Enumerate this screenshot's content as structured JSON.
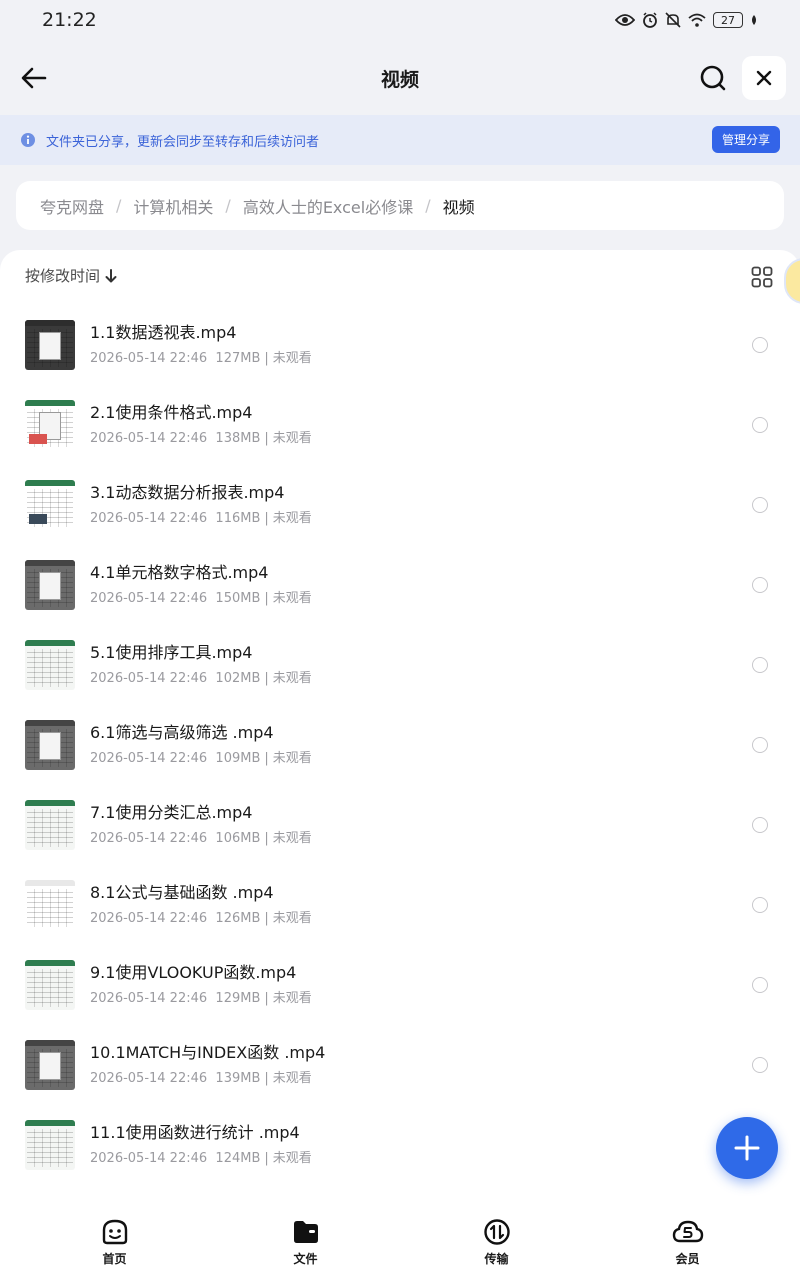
{
  "status_bar": {
    "time": "21:22",
    "battery": "27",
    "icons": [
      "eye-icon",
      "alarm-icon",
      "mute-icon",
      "wifi-icon",
      "battery-icon",
      "leaf-icon"
    ]
  },
  "header": {
    "title": "视频",
    "back_icon": "arrow-left-icon",
    "search_icon": "search-icon",
    "close_icon": "close-icon"
  },
  "share_banner": {
    "text": "文件夹已分享，更新会同步至转存和后续访问者",
    "button": "管理分享",
    "accent": "#3364e8"
  },
  "breadcrumb": [
    "夸克网盘",
    "计算机相关",
    "高效人士的Excel必修课",
    "视频"
  ],
  "sort": {
    "label": "按修改时间",
    "direction_icon": "arrow-down-icon"
  },
  "files": [
    {
      "name": "1.1数据透视表.mp4",
      "date": "2026-05-14 22:46",
      "size": "127MB",
      "status": "未观看",
      "thumb_style": "dark"
    },
    {
      "name": "2.1使用条件格式.mp4",
      "date": "2026-05-14 22:46",
      "size": "138MB",
      "status": "未观看",
      "thumb_style": "red"
    },
    {
      "name": "3.1动态数据分析报表.mp4",
      "date": "2026-05-14 22:46",
      "size": "116MB",
      "status": "未观看",
      "thumb_style": "chart"
    },
    {
      "name": "4.1单元格数字格式.mp4",
      "date": "2026-05-14 22:46",
      "size": "150MB",
      "status": "未观看",
      "thumb_style": "gray"
    },
    {
      "name": "5.1使用排序工具.mp4",
      "date": "2026-05-14 22:46",
      "size": "102MB",
      "status": "未观看",
      "thumb_style": "light"
    },
    {
      "name": "6.1筛选与高级筛选 .mp4",
      "date": "2026-05-14 22:46",
      "size": "109MB",
      "status": "未观看",
      "thumb_style": "gray"
    },
    {
      "name": "7.1使用分类汇总.mp4",
      "date": "2026-05-14 22:46",
      "size": "106MB",
      "status": "未观看",
      "thumb_style": "light"
    },
    {
      "name": "8.1公式与基础函数 .mp4",
      "date": "2026-05-14 22:46",
      "size": "126MB",
      "status": "未观看",
      "thumb_style": "white"
    },
    {
      "name": "9.1使用VLOOKUP函数.mp4",
      "date": "2026-05-14 22:46",
      "size": "129MB",
      "status": "未观看",
      "thumb_style": "light"
    },
    {
      "name": "10.1MATCH与INDEX函数 .mp4",
      "date": "2026-05-14 22:46",
      "size": "139MB",
      "status": "未观看",
      "thumb_style": "gray"
    },
    {
      "name": "11.1使用函数进行统计 .mp4",
      "date": "2026-05-14 22:46",
      "size": "124MB",
      "status": "未观看",
      "thumb_style": "light"
    }
  ],
  "fab_icon": "plus-icon",
  "bottom_nav": [
    {
      "label": "首页",
      "icon": "home-face-icon"
    },
    {
      "label": "文件",
      "icon": "folder-icon"
    },
    {
      "label": "传输",
      "icon": "transfer-icon"
    },
    {
      "label": "会员",
      "icon": "cloud-member-icon"
    }
  ]
}
